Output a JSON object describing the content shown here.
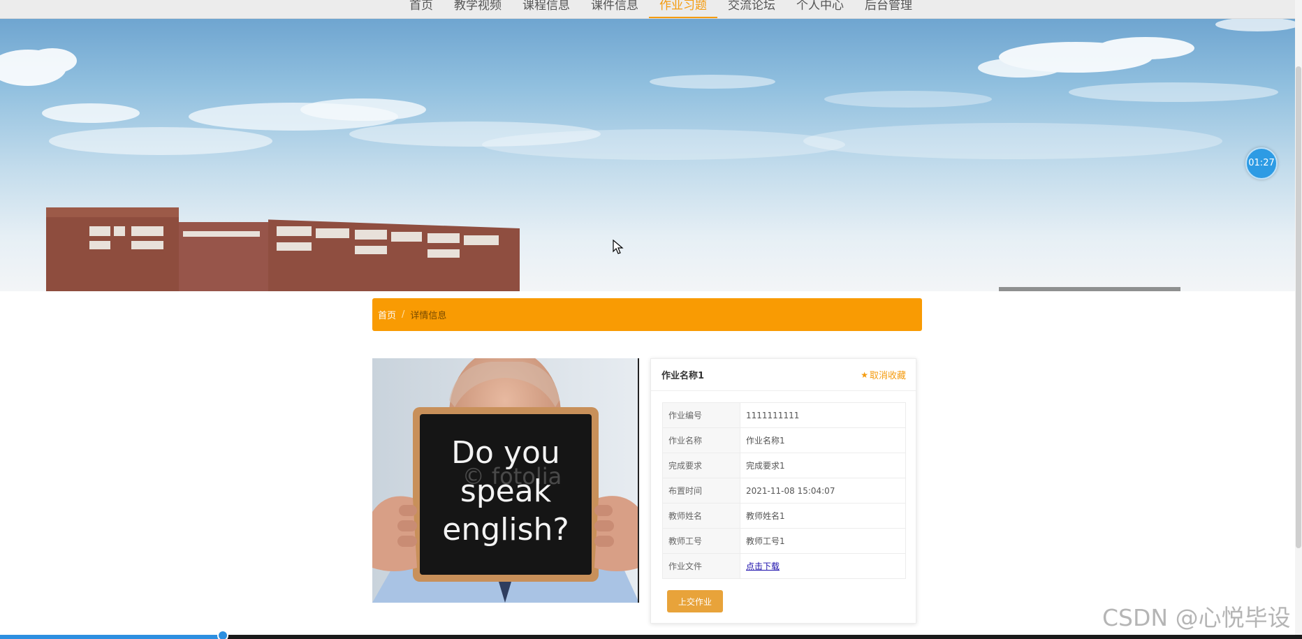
{
  "nav": {
    "items": [
      {
        "label": "首页",
        "active": false
      },
      {
        "label": "教学视频",
        "active": false
      },
      {
        "label": "课程信息",
        "active": false
      },
      {
        "label": "课件信息",
        "active": false
      },
      {
        "label": "作业习题",
        "active": true
      },
      {
        "label": "交流论坛",
        "active": false
      },
      {
        "label": "个人中心",
        "active": false
      },
      {
        "label": "后台管理",
        "active": false
      }
    ]
  },
  "timer": "01:27",
  "breadcrumb": {
    "home": "首页",
    "separator": "/",
    "current": "详情信息"
  },
  "photo": {
    "sign_lines": [
      "Do you",
      "speak",
      "english?"
    ],
    "stock_mark": "© fotolia"
  },
  "card": {
    "title": "作业名称1",
    "favorite_label": "取消收藏",
    "rows": [
      {
        "key": "作业编号",
        "value": "1111111111"
      },
      {
        "key": "作业名称",
        "value": "作业名称1"
      },
      {
        "key": "完成要求",
        "value": "完成要求1"
      },
      {
        "key": "布置时间",
        "value": "2021-11-08 15:04:07"
      },
      {
        "key": "教师姓名",
        "value": "教师姓名1"
      },
      {
        "key": "教师工号",
        "value": "教师工号1"
      }
    ],
    "file_row": {
      "key": "作业文件",
      "link_label": "点击下载"
    },
    "submit_label": "上交作业"
  },
  "video_progress": 0.171,
  "watermark": "CSDN @心悦毕设",
  "colors": {
    "accent": "#f99b03",
    "nav_active": "#f49b0f",
    "button": "#e8a33a",
    "link": "#1a0dab",
    "timer": "#2d9be4"
  }
}
